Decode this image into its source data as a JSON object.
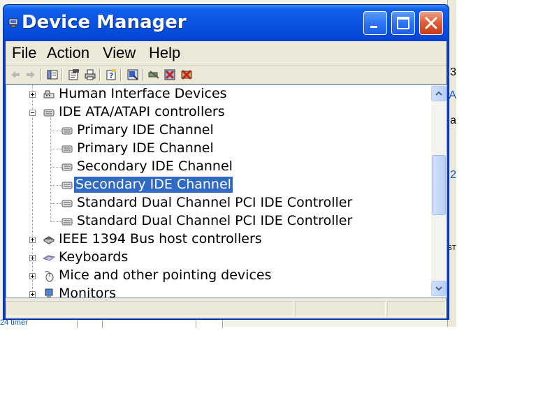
{
  "window": {
    "title": "Device Manager"
  },
  "menubar": {
    "items": [
      "File",
      "Action",
      "View",
      "Help"
    ]
  },
  "toolbar": {
    "buttons": [
      {
        "icon": "back-arrow-icon"
      },
      {
        "icon": "forward-arrow-icon"
      },
      {
        "icon": "show-hide-console-tree-icon"
      },
      {
        "icon": "properties-icon"
      },
      {
        "icon": "print-icon"
      },
      {
        "icon": "help-icon"
      },
      {
        "icon": "update-driver-icon"
      },
      {
        "icon": "scan-hardware-changes-icon"
      },
      {
        "icon": "uninstall-icon"
      },
      {
        "icon": "disable-device-icon"
      }
    ]
  },
  "tree": {
    "nodes": [
      {
        "label": "Human Interface Devices",
        "level": 0,
        "expander": "+",
        "icon": "hid-icon"
      },
      {
        "label": "IDE ATA/ATAPI controllers",
        "level": 0,
        "expander": "-",
        "icon": "ide-controller-icon"
      },
      {
        "label": "Primary IDE Channel",
        "level": 1,
        "icon": "ide-channel-icon"
      },
      {
        "label": "Primary IDE Channel",
        "level": 1,
        "icon": "ide-channel-icon"
      },
      {
        "label": "Secondary IDE Channel",
        "level": 1,
        "icon": "ide-channel-icon"
      },
      {
        "label": "Secondary IDE Channel",
        "level": 1,
        "icon": "ide-channel-icon",
        "selected": true
      },
      {
        "label": "Standard Dual Channel PCI IDE Controller",
        "level": 1,
        "icon": "ide-channel-icon"
      },
      {
        "label": "Standard Dual Channel PCI IDE Controller",
        "level": 1,
        "icon": "ide-channel-icon"
      },
      {
        "label": "IEEE 1394 Bus host controllers",
        "level": 0,
        "expander": "+",
        "icon": "ieee1394-icon"
      },
      {
        "label": "Keyboards",
        "level": 0,
        "expander": "+",
        "icon": "keyboard-icon"
      },
      {
        "label": "Mice and other pointing devices",
        "level": 0,
        "expander": "+",
        "icon": "mouse-icon"
      },
      {
        "label": "Monitors",
        "level": 0,
        "expander": "+",
        "icon": "monitor-icon"
      }
    ]
  },
  "background": {
    "bottom_text": "24 timer",
    "right_fragments": [
      "3",
      "A",
      "a",
      "2",
      "ST"
    ]
  },
  "colors": {
    "titlebar": "#0a52e0",
    "selection": "#316ac5",
    "close_button": "#e0613c"
  }
}
